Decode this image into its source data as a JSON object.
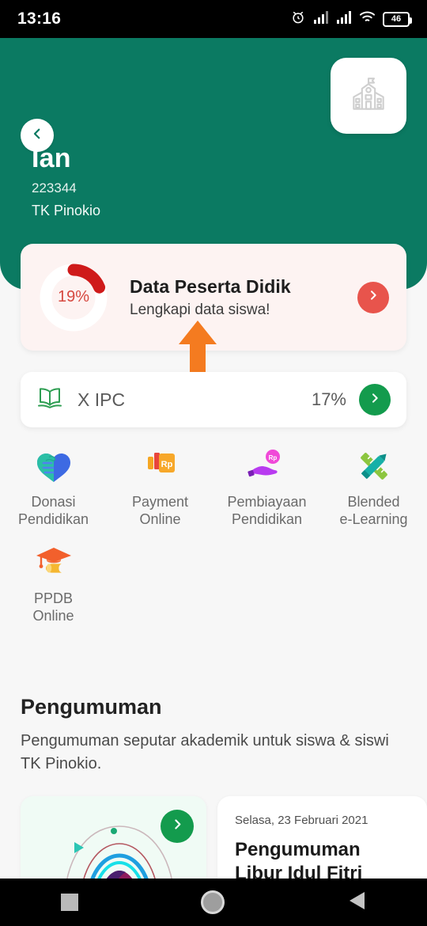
{
  "statusbar": {
    "time": "13:16",
    "alarm_icon": "alarm-clock-icon",
    "signal1_icon": "signal-bars-icon",
    "signal2_icon": "signal-bars-icon",
    "wifi_icon": "wifi-icon",
    "battery_level": "46"
  },
  "header": {
    "back_icon": "chevron-left-icon",
    "school_icon": "school-building-icon",
    "student_name": "Ian",
    "student_id": "223344",
    "school_name": "TK Pinokio"
  },
  "data_card": {
    "percent_label": "19%",
    "percent_value": 19,
    "title": "Data Peserta Didik",
    "subtitle": "Lengkapi data siswa!",
    "arrow_icon": "chevron-right-icon",
    "accent_color": "#e8544c",
    "background_color": "#fdf3f2"
  },
  "annotation": {
    "arrow_icon": "up-arrow-annotation",
    "color": "#f47b20"
  },
  "class_card": {
    "book_icon": "open-book-icon",
    "label": "X IPC",
    "percent_label": "17%",
    "arrow_icon": "chevron-right-icon",
    "accent_color": "#139b4d"
  },
  "menu": {
    "items": [
      {
        "icon": "donation-hands-heart-icon",
        "line1": "Donasi",
        "line2": "Pendidikan"
      },
      {
        "icon": "payment-rupiah-card-icon",
        "line1": "Payment",
        "line2": "Online"
      },
      {
        "icon": "financing-hand-coin-icon",
        "line1": "Pembiayaan",
        "line2": "Pendidikan"
      },
      {
        "icon": "pen-ruler-icon",
        "line1": "Blended",
        "line2": "e-Learning"
      },
      {
        "icon": "graduation-cap-icon",
        "line1": "PPDB",
        "line2": "Online"
      }
    ]
  },
  "announcement": {
    "section_title": "Pengumuman",
    "section_subtitle": "Pengumuman seputar akademik untuk siswa & siswi TK Pinokio.",
    "illustration_card": {
      "illustration_name": "abstract-wave-illustration",
      "arrow_icon": "chevron-right-icon"
    },
    "text_card": {
      "date": "Selasa, 23 Februari 2021",
      "headline": "Pengumuman Libur Idul Fitri"
    }
  },
  "navbar": {
    "recents_icon": "square-recents-icon",
    "home_icon": "circle-home-icon",
    "back_icon": "triangle-back-icon"
  },
  "colors": {
    "brand_green": "#0b7a62",
    "accent_green": "#139b4d",
    "accent_red": "#e8544c",
    "annotation_orange": "#f47b20"
  }
}
